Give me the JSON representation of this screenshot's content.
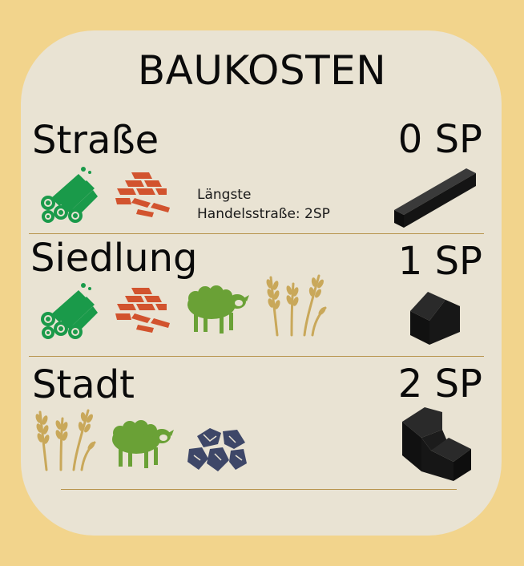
{
  "title": "BAUKOSTEN",
  "sections": [
    {
      "name": "Straße",
      "points": "0 SP",
      "resources": [
        "wood-icon",
        "brick-icon"
      ],
      "note": [
        "Längste",
        "Handelsstraße: 2SP"
      ],
      "piece": "road-piece"
    },
    {
      "name": "Siedlung",
      "points": "1 SP",
      "resources": [
        "wood-icon",
        "brick-icon",
        "sheep-icon",
        "wheat-icon"
      ],
      "piece": "settlement-piece"
    },
    {
      "name": "Stadt",
      "points": "2 SP",
      "resources": [
        "wheat-icon",
        "sheep-icon",
        "ore-icon"
      ],
      "piece": "city-piece"
    }
  ],
  "colors": {
    "background": "#f2d48c",
    "card": "#e9e3d3",
    "divider": "#b8954e",
    "wood": "#1a9a4a",
    "brick": "#d2532e",
    "sheep": "#6aa136",
    "wheat": "#c9a85a",
    "ore": "#3e4768",
    "piece": "#141414"
  }
}
